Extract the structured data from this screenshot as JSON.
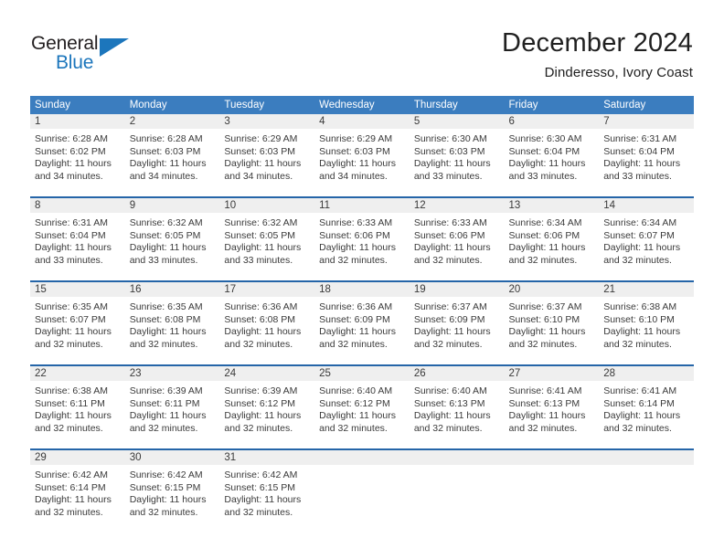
{
  "branding": {
    "logo_word_1": "General",
    "logo_word_2": "Blue",
    "colors": {
      "brand_blue": "#1c76bc",
      "header_blue": "#3b7dbf",
      "rule_blue": "#2565a8",
      "daybar_gray": "#efefef"
    }
  },
  "header": {
    "title": "December 2024",
    "subtitle": "Dinderesso, Ivory Coast"
  },
  "calendar": {
    "weekday_headers": [
      "Sunday",
      "Monday",
      "Tuesday",
      "Wednesday",
      "Thursday",
      "Friday",
      "Saturday"
    ],
    "weeks": [
      [
        {
          "day": "1",
          "sunrise": "Sunrise: 6:28 AM",
          "sunset": "Sunset: 6:02 PM",
          "daylight_1": "Daylight: 11 hours",
          "daylight_2": "and 34 minutes."
        },
        {
          "day": "2",
          "sunrise": "Sunrise: 6:28 AM",
          "sunset": "Sunset: 6:03 PM",
          "daylight_1": "Daylight: 11 hours",
          "daylight_2": "and 34 minutes."
        },
        {
          "day": "3",
          "sunrise": "Sunrise: 6:29 AM",
          "sunset": "Sunset: 6:03 PM",
          "daylight_1": "Daylight: 11 hours",
          "daylight_2": "and 34 minutes."
        },
        {
          "day": "4",
          "sunrise": "Sunrise: 6:29 AM",
          "sunset": "Sunset: 6:03 PM",
          "daylight_1": "Daylight: 11 hours",
          "daylight_2": "and 34 minutes."
        },
        {
          "day": "5",
          "sunrise": "Sunrise: 6:30 AM",
          "sunset": "Sunset: 6:03 PM",
          "daylight_1": "Daylight: 11 hours",
          "daylight_2": "and 33 minutes."
        },
        {
          "day": "6",
          "sunrise": "Sunrise: 6:30 AM",
          "sunset": "Sunset: 6:04 PM",
          "daylight_1": "Daylight: 11 hours",
          "daylight_2": "and 33 minutes."
        },
        {
          "day": "7",
          "sunrise": "Sunrise: 6:31 AM",
          "sunset": "Sunset: 6:04 PM",
          "daylight_1": "Daylight: 11 hours",
          "daylight_2": "and 33 minutes."
        }
      ],
      [
        {
          "day": "8",
          "sunrise": "Sunrise: 6:31 AM",
          "sunset": "Sunset: 6:04 PM",
          "daylight_1": "Daylight: 11 hours",
          "daylight_2": "and 33 minutes."
        },
        {
          "day": "9",
          "sunrise": "Sunrise: 6:32 AM",
          "sunset": "Sunset: 6:05 PM",
          "daylight_1": "Daylight: 11 hours",
          "daylight_2": "and 33 minutes."
        },
        {
          "day": "10",
          "sunrise": "Sunrise: 6:32 AM",
          "sunset": "Sunset: 6:05 PM",
          "daylight_1": "Daylight: 11 hours",
          "daylight_2": "and 33 minutes."
        },
        {
          "day": "11",
          "sunrise": "Sunrise: 6:33 AM",
          "sunset": "Sunset: 6:06 PM",
          "daylight_1": "Daylight: 11 hours",
          "daylight_2": "and 32 minutes."
        },
        {
          "day": "12",
          "sunrise": "Sunrise: 6:33 AM",
          "sunset": "Sunset: 6:06 PM",
          "daylight_1": "Daylight: 11 hours",
          "daylight_2": "and 32 minutes."
        },
        {
          "day": "13",
          "sunrise": "Sunrise: 6:34 AM",
          "sunset": "Sunset: 6:06 PM",
          "daylight_1": "Daylight: 11 hours",
          "daylight_2": "and 32 minutes."
        },
        {
          "day": "14",
          "sunrise": "Sunrise: 6:34 AM",
          "sunset": "Sunset: 6:07 PM",
          "daylight_1": "Daylight: 11 hours",
          "daylight_2": "and 32 minutes."
        }
      ],
      [
        {
          "day": "15",
          "sunrise": "Sunrise: 6:35 AM",
          "sunset": "Sunset: 6:07 PM",
          "daylight_1": "Daylight: 11 hours",
          "daylight_2": "and 32 minutes."
        },
        {
          "day": "16",
          "sunrise": "Sunrise: 6:35 AM",
          "sunset": "Sunset: 6:08 PM",
          "daylight_1": "Daylight: 11 hours",
          "daylight_2": "and 32 minutes."
        },
        {
          "day": "17",
          "sunrise": "Sunrise: 6:36 AM",
          "sunset": "Sunset: 6:08 PM",
          "daylight_1": "Daylight: 11 hours",
          "daylight_2": "and 32 minutes."
        },
        {
          "day": "18",
          "sunrise": "Sunrise: 6:36 AM",
          "sunset": "Sunset: 6:09 PM",
          "daylight_1": "Daylight: 11 hours",
          "daylight_2": "and 32 minutes."
        },
        {
          "day": "19",
          "sunrise": "Sunrise: 6:37 AM",
          "sunset": "Sunset: 6:09 PM",
          "daylight_1": "Daylight: 11 hours",
          "daylight_2": "and 32 minutes."
        },
        {
          "day": "20",
          "sunrise": "Sunrise: 6:37 AM",
          "sunset": "Sunset: 6:10 PM",
          "daylight_1": "Daylight: 11 hours",
          "daylight_2": "and 32 minutes."
        },
        {
          "day": "21",
          "sunrise": "Sunrise: 6:38 AM",
          "sunset": "Sunset: 6:10 PM",
          "daylight_1": "Daylight: 11 hours",
          "daylight_2": "and 32 minutes."
        }
      ],
      [
        {
          "day": "22",
          "sunrise": "Sunrise: 6:38 AM",
          "sunset": "Sunset: 6:11 PM",
          "daylight_1": "Daylight: 11 hours",
          "daylight_2": "and 32 minutes."
        },
        {
          "day": "23",
          "sunrise": "Sunrise: 6:39 AM",
          "sunset": "Sunset: 6:11 PM",
          "daylight_1": "Daylight: 11 hours",
          "daylight_2": "and 32 minutes."
        },
        {
          "day": "24",
          "sunrise": "Sunrise: 6:39 AM",
          "sunset": "Sunset: 6:12 PM",
          "daylight_1": "Daylight: 11 hours",
          "daylight_2": "and 32 minutes."
        },
        {
          "day": "25",
          "sunrise": "Sunrise: 6:40 AM",
          "sunset": "Sunset: 6:12 PM",
          "daylight_1": "Daylight: 11 hours",
          "daylight_2": "and 32 minutes."
        },
        {
          "day": "26",
          "sunrise": "Sunrise: 6:40 AM",
          "sunset": "Sunset: 6:13 PM",
          "daylight_1": "Daylight: 11 hours",
          "daylight_2": "and 32 minutes."
        },
        {
          "day": "27",
          "sunrise": "Sunrise: 6:41 AM",
          "sunset": "Sunset: 6:13 PM",
          "daylight_1": "Daylight: 11 hours",
          "daylight_2": "and 32 minutes."
        },
        {
          "day": "28",
          "sunrise": "Sunrise: 6:41 AM",
          "sunset": "Sunset: 6:14 PM",
          "daylight_1": "Daylight: 11 hours",
          "daylight_2": "and 32 minutes."
        }
      ],
      [
        {
          "day": "29",
          "sunrise": "Sunrise: 6:42 AM",
          "sunset": "Sunset: 6:14 PM",
          "daylight_1": "Daylight: 11 hours",
          "daylight_2": "and 32 minutes."
        },
        {
          "day": "30",
          "sunrise": "Sunrise: 6:42 AM",
          "sunset": "Sunset: 6:15 PM",
          "daylight_1": "Daylight: 11 hours",
          "daylight_2": "and 32 minutes."
        },
        {
          "day": "31",
          "sunrise": "Sunrise: 6:42 AM",
          "sunset": "Sunset: 6:15 PM",
          "daylight_1": "Daylight: 11 hours",
          "daylight_2": "and 32 minutes."
        },
        {
          "day": "",
          "sunrise": "",
          "sunset": "",
          "daylight_1": "",
          "daylight_2": ""
        },
        {
          "day": "",
          "sunrise": "",
          "sunset": "",
          "daylight_1": "",
          "daylight_2": ""
        },
        {
          "day": "",
          "sunrise": "",
          "sunset": "",
          "daylight_1": "",
          "daylight_2": ""
        },
        {
          "day": "",
          "sunrise": "",
          "sunset": "",
          "daylight_1": "",
          "daylight_2": ""
        }
      ]
    ]
  }
}
